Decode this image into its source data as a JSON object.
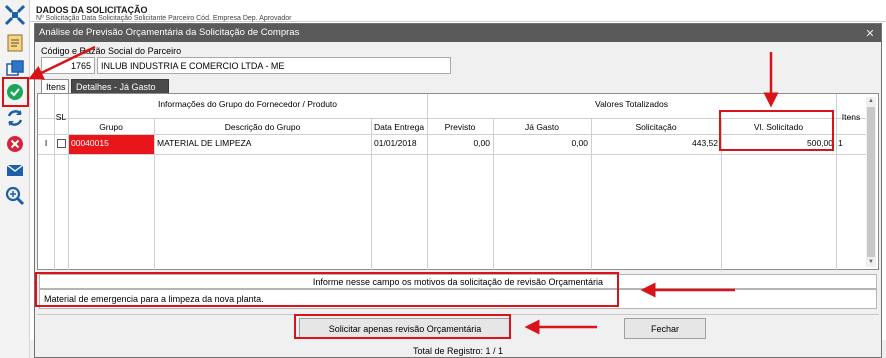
{
  "page": {
    "header_title": "DADOS DA SOLICITAÇÃO",
    "header_sub": "Nº Solicitação  Data Solicitação  Solicitante                              Parceiro                                                           Cód. Empresa    Dep. Aprovador"
  },
  "toolbar": {
    "items": [
      {
        "icon": "grid-icon"
      },
      {
        "icon": "document-icon"
      },
      {
        "icon": "windows-icon"
      },
      {
        "icon": "approve-check-icon"
      },
      {
        "icon": "refresh-icon"
      },
      {
        "icon": "cancel-icon"
      },
      {
        "icon": "mail-icon"
      },
      {
        "icon": "zoom-icon"
      }
    ]
  },
  "dialog": {
    "title": "Análise de Previsão Orçamentária da Solicitação de Compras",
    "close_symbol": "✕",
    "partner": {
      "label": "Código e Razão Social do Parceiro",
      "code": "1765",
      "name": "INLUB INDUSTRIA E COMERCIO LTDA  - ME"
    },
    "tabs": [
      "Itens",
      "Detalhes - Já Gasto"
    ],
    "grid": {
      "group_header_left": "Informações do Grupo do Fornecedor / Produto",
      "group_header_right": "Valores Totalizados",
      "col_sl": "SL",
      "col_itens": "Itens",
      "columns": [
        "Grupo",
        "Descrição do Grupo",
        "Data Entrega",
        "Previsto",
        "Já Gasto",
        "Solicitação",
        "Vl. Solicitado"
      ],
      "rows": [
        {
          "marker": "I",
          "grupo": "00040015",
          "descricao": "MATERIAL DE LIMPEZA",
          "data_entrega": "01/01/2018",
          "previsto": "0,00",
          "ja_gasto": "0,00",
          "solicitacao": "443,52",
          "vl_solicitado": "500,00",
          "itens": "1"
        }
      ]
    },
    "reason": {
      "label": "Informe nesse campo os motivos da solicitação de revisão Orçamentária",
      "value": "Material de emergencia para a limpeza da nova planta."
    },
    "buttons": {
      "request": "Solicitar apenas revisão Orçamentária",
      "close": "Fechar"
    },
    "footer": "Total de Registro: 1 / 1"
  },
  "colors": {
    "annotation": "#d9131a",
    "title_bar": "#5a5a5a",
    "highlight_cell": "#e8151b"
  }
}
